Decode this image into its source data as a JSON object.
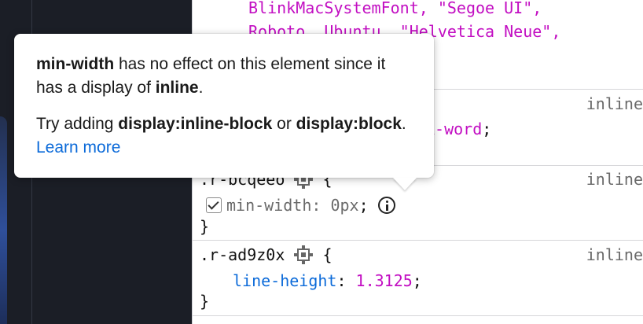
{
  "font_lines": {
    "line1": "BlinkMacSystemFont, \"Segoe UI\",",
    "line2": "Roboto, Ubuntu, \"Helvetica Neue\","
  },
  "rule2": {
    "partial_value": "k-word",
    "semicolon": ";",
    "source": "inline"
  },
  "rule3": {
    "selector": ".r-bcqeeo",
    "open_brace": "{",
    "property": "min-width",
    "colon": ":",
    "value": "0px",
    "semicolon": ";",
    "close_brace": "}",
    "source": "inline",
    "checked": true
  },
  "rule4": {
    "selector": ".r-ad9z0x",
    "open_brace": "{",
    "property": "line-height",
    "colon": ":",
    "value": "1.3125",
    "semicolon": ";",
    "close_brace": "}",
    "source": "inline"
  },
  "rule1_source": "inline",
  "tooltip": {
    "p1_prop": "min-width",
    "p1_text1": " has no effect on this element since it has a display of ",
    "p1_display": "inline",
    "p1_end": ".",
    "p2_text1": "Try adding ",
    "p2_code1": "display:inline-block",
    "p2_text2": " or ",
    "p2_code2": "display:block",
    "p2_text3": ". ",
    "p2_link": "Learn more"
  },
  "colors": {
    "value_magenta": "#c20ec2",
    "property_blue": "#0b6ad9",
    "link_blue": "#0b6ad9",
    "dark_pane": "#1b1e26"
  }
}
